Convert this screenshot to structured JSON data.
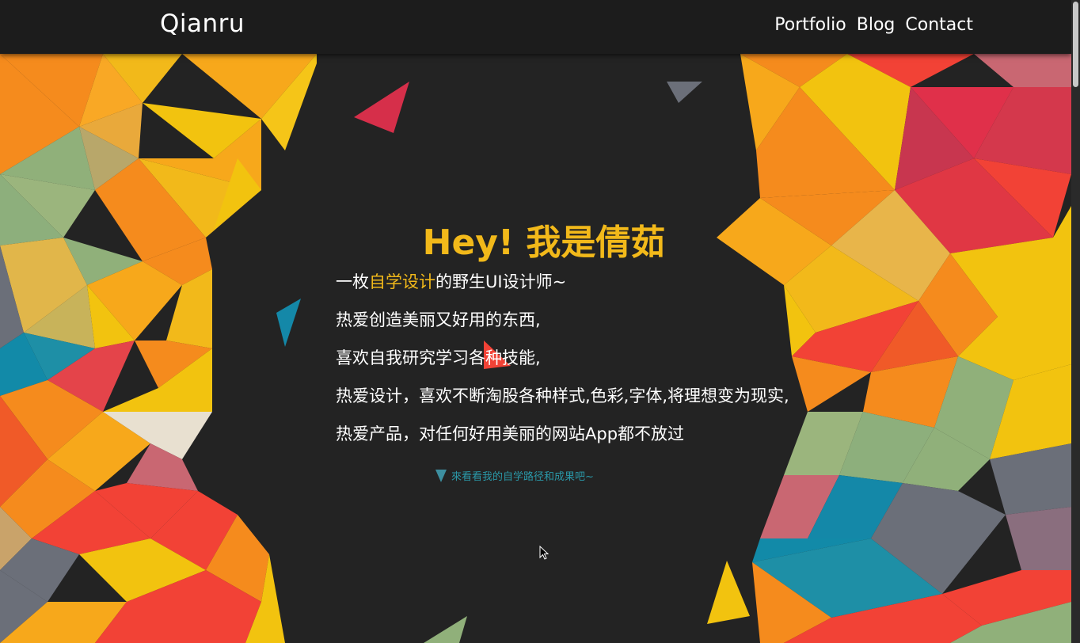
{
  "header": {
    "logo": "Qianru",
    "nav": [
      "Portfolio",
      "Blog",
      "Contact"
    ]
  },
  "hero": {
    "title": "Hey! 我是倩茹",
    "intro_prefix": "一枚",
    "intro_highlight": "自学设计",
    "intro_suffix": "的野生UI设计师~",
    "lines": [
      "热爱创造美丽又好用的东西,",
      "喜欢自我研究学习各种技能,",
      "热爱设计，喜欢不断淘股各种样式,色彩,字体,将理想变为现实,",
      "热爱产品，对任何好用美丽的网站App都不放过"
    ],
    "explore_link": "來看看我的自学路径和成果吧~"
  },
  "colors": {
    "accent": "#f2b91a",
    "background": "#232323",
    "link": "#2a98a8"
  }
}
